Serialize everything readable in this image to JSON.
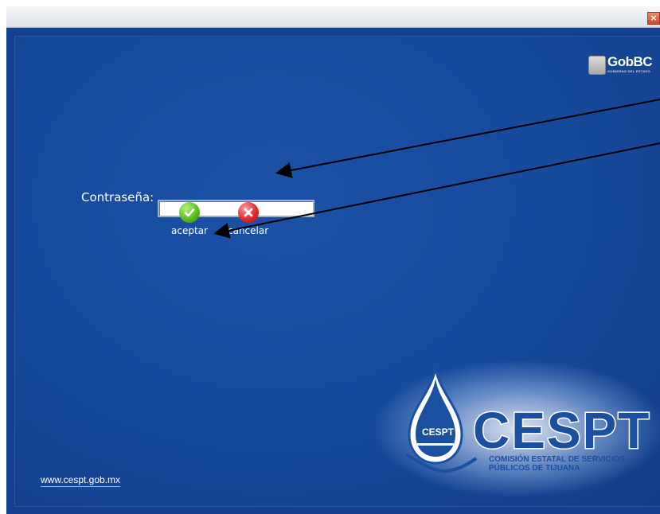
{
  "titlebar": {
    "close_icon": "close-icon",
    "close_glyph": "×"
  },
  "branding": {
    "gobbc_text": "GobBC",
    "gobbc_sub": "GOBIERNO DEL ESTADO",
    "cespt_name": "CESPT",
    "cespt_subtitle_line1": "COMISIÓN ESTATAL DE SERVICIOS",
    "cespt_subtitle_line2": "PÚBLICOS DE TIJUANA",
    "drop_text": "CESPT"
  },
  "login": {
    "password_label": "Contraseña:",
    "password_value": "",
    "accept_label": "aceptar",
    "cancel_label": "cancelar"
  },
  "footer": {
    "url": "www.cespt.gob.mx"
  },
  "colors": {
    "background": "#14418f",
    "accept": "#5cbf1f",
    "cancel": "#e02a2a",
    "brand": "#1b4fa0"
  }
}
